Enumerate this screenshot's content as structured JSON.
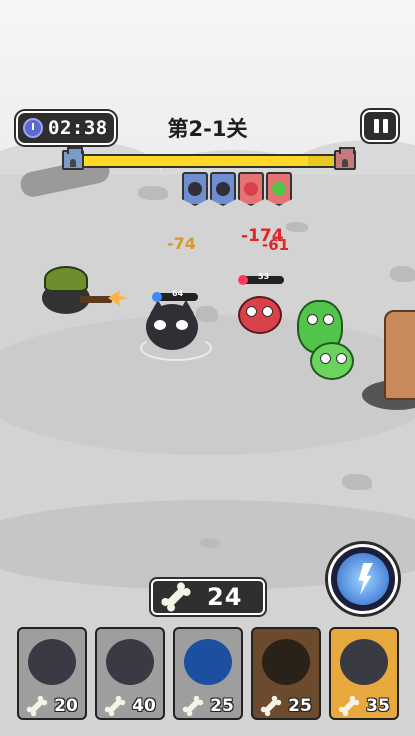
{
  "hud": {
    "timer": "02:38",
    "level_title": "第2-1关",
    "progress": 0.88
  },
  "wave_icons": [
    {
      "type": "ally",
      "icon": "soldier-dog-icon"
    },
    {
      "type": "ally",
      "icon": "husky-icon"
    },
    {
      "type": "enemy",
      "icon": "red-monster-icon"
    },
    {
      "type": "enemy",
      "icon": "green-monster-icon"
    }
  ],
  "battlefield": {
    "ally_hp": "64",
    "enemy_hp": "53",
    "damage_numbers": [
      "-74",
      "-174",
      "-61"
    ]
  },
  "resource": {
    "bones": "24"
  },
  "skill": {
    "icon": "lightning-skill-icon"
  },
  "cards": [
    {
      "name": "husky-card",
      "cost": "20",
      "state": "available"
    },
    {
      "name": "shiba-card",
      "cost": "40",
      "state": "available"
    },
    {
      "name": "blue-husky-card",
      "cost": "25",
      "state": "available"
    },
    {
      "name": "soldier-card",
      "cost": "25",
      "state": "locked"
    },
    {
      "name": "ninja-card",
      "cost": "35",
      "state": "selected"
    }
  ],
  "colors": {
    "progress_fill": "#ffd928",
    "damage_red": "#e0262b",
    "damage_orange": "#d99a2b"
  }
}
